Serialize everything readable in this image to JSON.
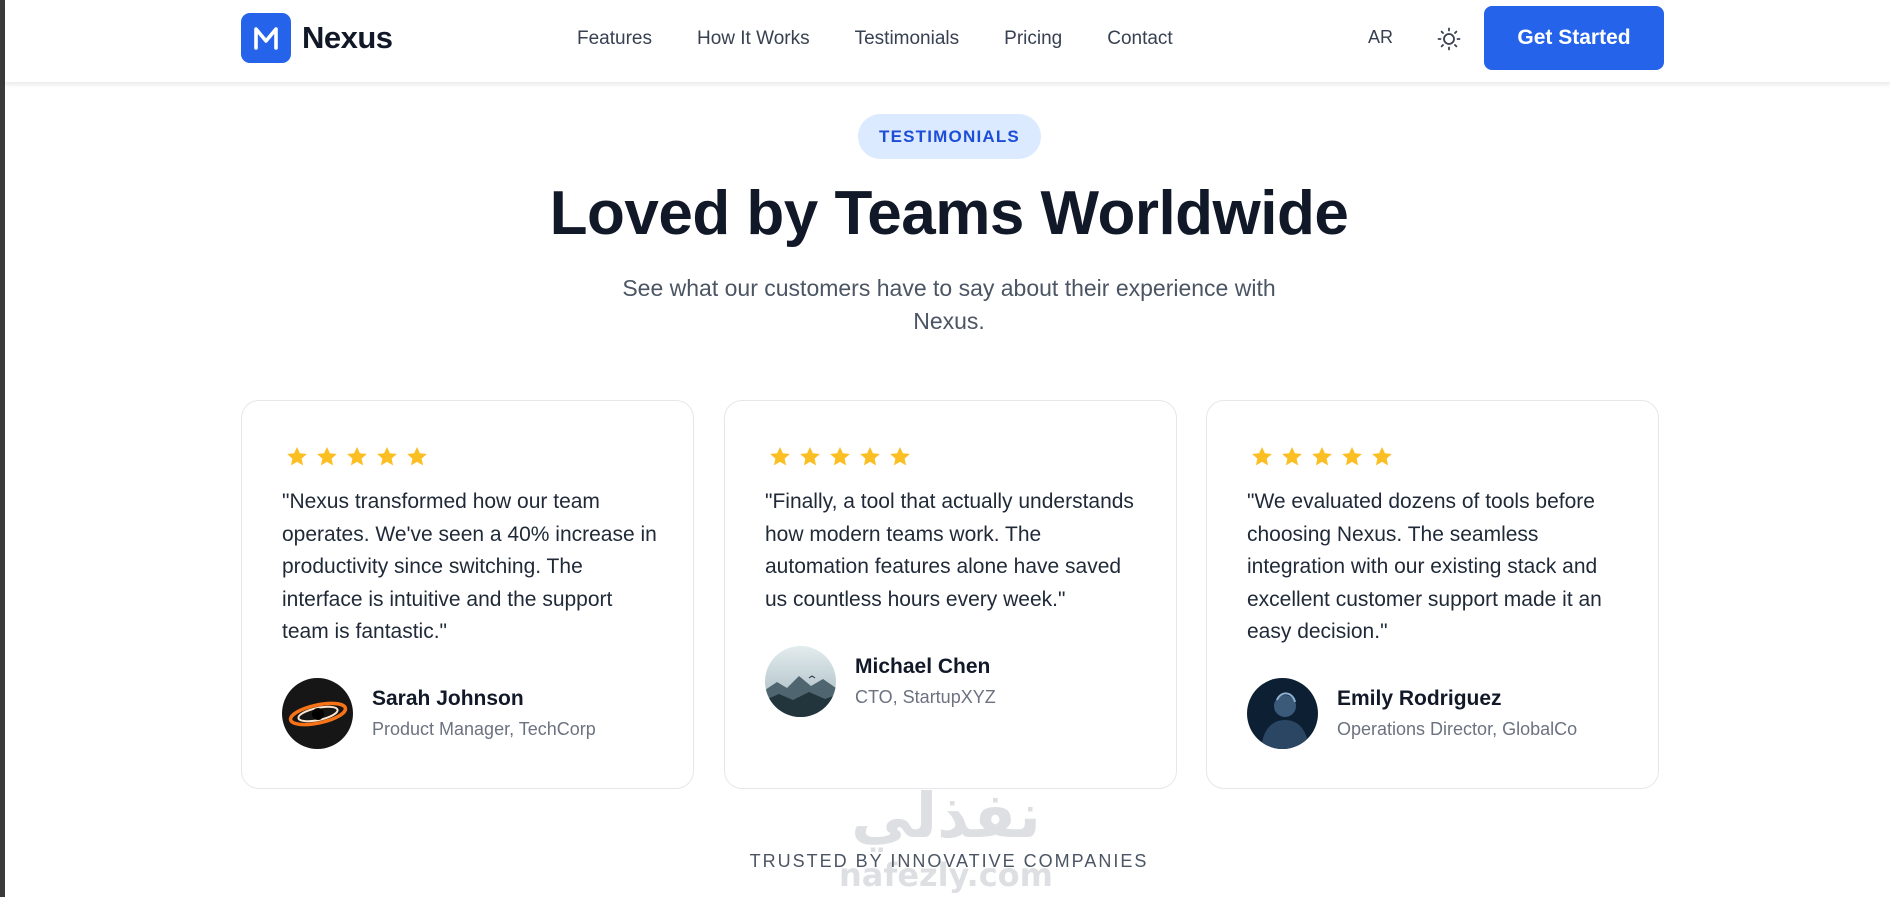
{
  "nav": {
    "brand": "Nexus",
    "links": [
      "Features",
      "How It Works",
      "Testimonials",
      "Pricing",
      "Contact"
    ],
    "lang_label": "AR",
    "cta_label": "Get Started"
  },
  "section": {
    "badge": "TESTIMONIALS",
    "title": "Loved by Teams Worldwide",
    "subtitle": "See what our customers have to say about their experience with Nexus."
  },
  "testimonials": [
    {
      "rating": 5,
      "quote": "\"Nexus transformed how our team operates. We've seen a 40% increase in productivity since switching. The interface is intuitive and the support team is fantastic.\"",
      "name": "Sarah Johnson",
      "role": "Product Manager, TechCorp"
    },
    {
      "rating": 5,
      "quote": "\"Finally, a tool that actually understands how modern teams work. The automation features alone have saved us countless hours every week.\"",
      "name": "Michael Chen",
      "role": "CTO, StartupXYZ"
    },
    {
      "rating": 5,
      "quote": "\"We evaluated dozens of tools before choosing Nexus. The seamless integration with our existing stack and excellent customer support made it an easy decision.\"",
      "name": "Emily Rodriguez",
      "role": "Operations Director, GlobalCo"
    }
  ],
  "trusted_heading": "TRUSTED BY INNOVATIVE COMPANIES",
  "watermark": {
    "text_ar": "نفذلي",
    "text_latin": "nafezly.com"
  },
  "icons": {
    "logo": "m-logo-icon",
    "theme": "sun-icon",
    "rating": "star-icon"
  },
  "colors": {
    "accent": "#2563eb",
    "badge_bg": "#dbeafe",
    "star": "#fbbf24",
    "heading": "#111827",
    "muted": "#6b7280"
  }
}
